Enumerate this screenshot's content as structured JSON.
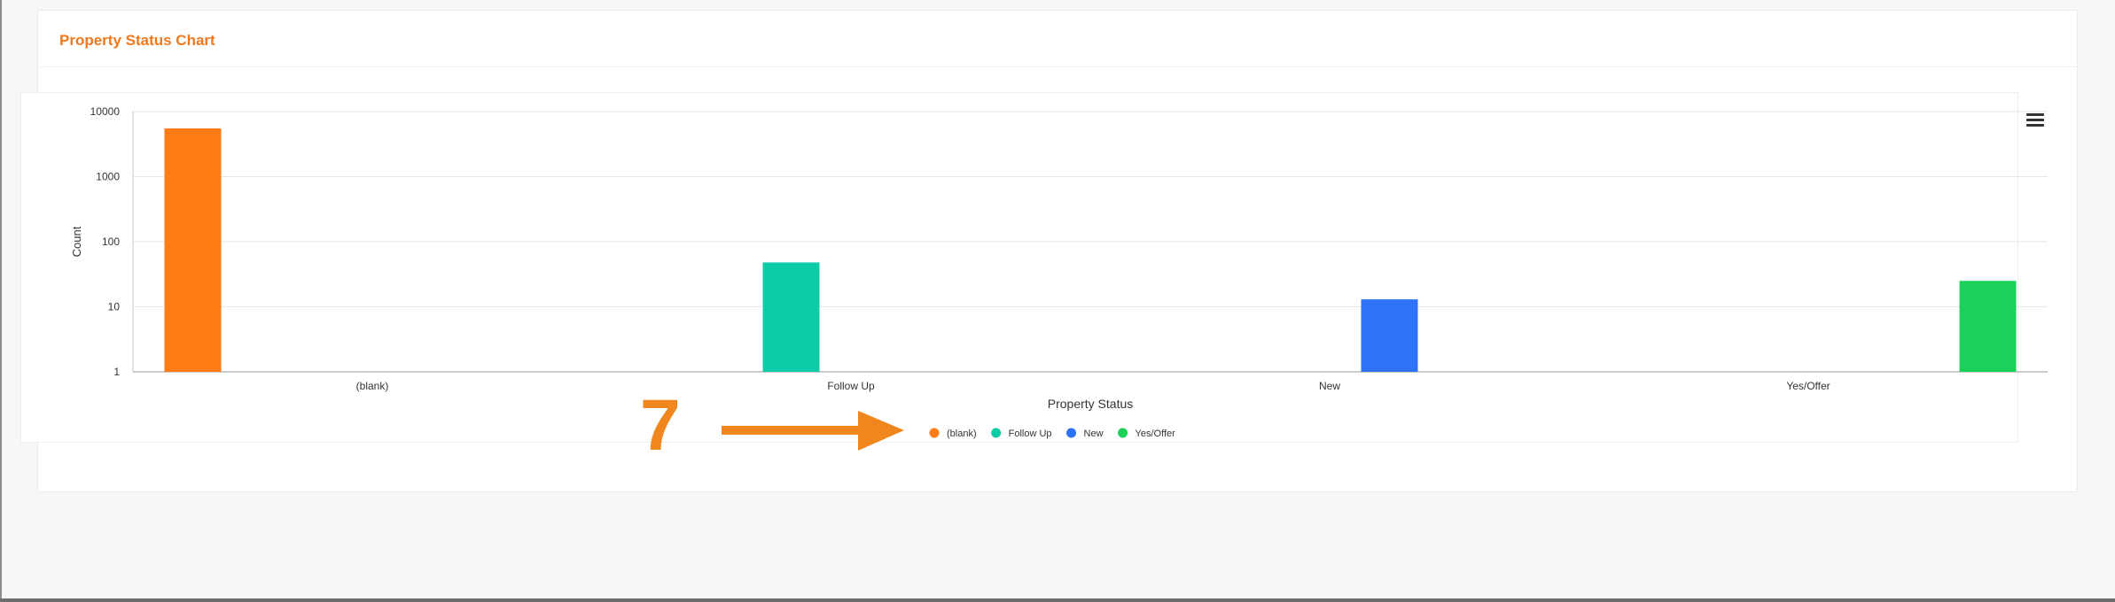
{
  "card": {
    "title": "Property Status Chart"
  },
  "annotation": {
    "number": "7"
  },
  "toolbar": {
    "menu_icon": "hamburger-menu-icon"
  },
  "colors": {
    "accent": "#f0781d",
    "blank": "#ff7b15",
    "follow_up": "#0ecba8",
    "new": "#2e73f7",
    "yes_offer": "#1dd05a"
  },
  "chart_data": {
    "type": "bar",
    "title": "",
    "xlabel": "Property Status",
    "ylabel": "Count",
    "yscale": "log",
    "ylim": [
      1,
      10000
    ],
    "yticks": [
      "1",
      "10",
      "100",
      "1000",
      "10000"
    ],
    "categories": [
      "(blank)",
      "Follow Up",
      "New",
      "Yes/Offer"
    ],
    "series": [
      {
        "name": "(blank)",
        "values": [
          5500,
          null,
          null,
          null
        ],
        "color": "#ff7b15"
      },
      {
        "name": "Follow Up",
        "values": [
          null,
          48,
          null,
          null
        ],
        "color": "#0ecba8"
      },
      {
        "name": "New",
        "values": [
          null,
          null,
          13,
          null
        ],
        "color": "#2e73f7"
      },
      {
        "name": "Yes/Offer",
        "values": [
          null,
          null,
          null,
          25
        ],
        "color": "#1dd05a"
      }
    ],
    "grid": true,
    "legend": "bottom-center"
  }
}
